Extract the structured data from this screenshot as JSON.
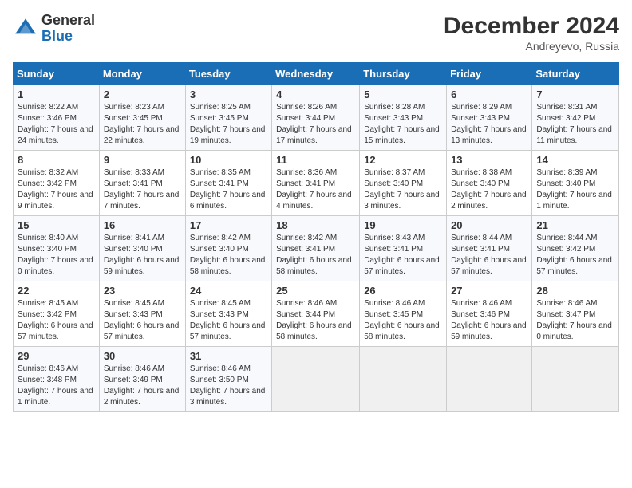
{
  "header": {
    "logo_general": "General",
    "logo_blue": "Blue",
    "month_title": "December 2024",
    "location": "Andreyevo, Russia"
  },
  "columns": [
    "Sunday",
    "Monday",
    "Tuesday",
    "Wednesday",
    "Thursday",
    "Friday",
    "Saturday"
  ],
  "weeks": [
    [
      {
        "day": "1",
        "sunrise": "Sunrise: 8:22 AM",
        "sunset": "Sunset: 3:46 PM",
        "daylight": "Daylight: 7 hours and 24 minutes."
      },
      {
        "day": "2",
        "sunrise": "Sunrise: 8:23 AM",
        "sunset": "Sunset: 3:45 PM",
        "daylight": "Daylight: 7 hours and 22 minutes."
      },
      {
        "day": "3",
        "sunrise": "Sunrise: 8:25 AM",
        "sunset": "Sunset: 3:45 PM",
        "daylight": "Daylight: 7 hours and 19 minutes."
      },
      {
        "day": "4",
        "sunrise": "Sunrise: 8:26 AM",
        "sunset": "Sunset: 3:44 PM",
        "daylight": "Daylight: 7 hours and 17 minutes."
      },
      {
        "day": "5",
        "sunrise": "Sunrise: 8:28 AM",
        "sunset": "Sunset: 3:43 PM",
        "daylight": "Daylight: 7 hours and 15 minutes."
      },
      {
        "day": "6",
        "sunrise": "Sunrise: 8:29 AM",
        "sunset": "Sunset: 3:43 PM",
        "daylight": "Daylight: 7 hours and 13 minutes."
      },
      {
        "day": "7",
        "sunrise": "Sunrise: 8:31 AM",
        "sunset": "Sunset: 3:42 PM",
        "daylight": "Daylight: 7 hours and 11 minutes."
      }
    ],
    [
      {
        "day": "8",
        "sunrise": "Sunrise: 8:32 AM",
        "sunset": "Sunset: 3:42 PM",
        "daylight": "Daylight: 7 hours and 9 minutes."
      },
      {
        "day": "9",
        "sunrise": "Sunrise: 8:33 AM",
        "sunset": "Sunset: 3:41 PM",
        "daylight": "Daylight: 7 hours and 7 minutes."
      },
      {
        "day": "10",
        "sunrise": "Sunrise: 8:35 AM",
        "sunset": "Sunset: 3:41 PM",
        "daylight": "Daylight: 7 hours and 6 minutes."
      },
      {
        "day": "11",
        "sunrise": "Sunrise: 8:36 AM",
        "sunset": "Sunset: 3:41 PM",
        "daylight": "Daylight: 7 hours and 4 minutes."
      },
      {
        "day": "12",
        "sunrise": "Sunrise: 8:37 AM",
        "sunset": "Sunset: 3:40 PM",
        "daylight": "Daylight: 7 hours and 3 minutes."
      },
      {
        "day": "13",
        "sunrise": "Sunrise: 8:38 AM",
        "sunset": "Sunset: 3:40 PM",
        "daylight": "Daylight: 7 hours and 2 minutes."
      },
      {
        "day": "14",
        "sunrise": "Sunrise: 8:39 AM",
        "sunset": "Sunset: 3:40 PM",
        "daylight": "Daylight: 7 hours and 1 minute."
      }
    ],
    [
      {
        "day": "15",
        "sunrise": "Sunrise: 8:40 AM",
        "sunset": "Sunset: 3:40 PM",
        "daylight": "Daylight: 7 hours and 0 minutes."
      },
      {
        "day": "16",
        "sunrise": "Sunrise: 8:41 AM",
        "sunset": "Sunset: 3:40 PM",
        "daylight": "Daylight: 6 hours and 59 minutes."
      },
      {
        "day": "17",
        "sunrise": "Sunrise: 8:42 AM",
        "sunset": "Sunset: 3:40 PM",
        "daylight": "Daylight: 6 hours and 58 minutes."
      },
      {
        "day": "18",
        "sunrise": "Sunrise: 8:42 AM",
        "sunset": "Sunset: 3:41 PM",
        "daylight": "Daylight: 6 hours and 58 minutes."
      },
      {
        "day": "19",
        "sunrise": "Sunrise: 8:43 AM",
        "sunset": "Sunset: 3:41 PM",
        "daylight": "Daylight: 6 hours and 57 minutes."
      },
      {
        "day": "20",
        "sunrise": "Sunrise: 8:44 AM",
        "sunset": "Sunset: 3:41 PM",
        "daylight": "Daylight: 6 hours and 57 minutes."
      },
      {
        "day": "21",
        "sunrise": "Sunrise: 8:44 AM",
        "sunset": "Sunset: 3:42 PM",
        "daylight": "Daylight: 6 hours and 57 minutes."
      }
    ],
    [
      {
        "day": "22",
        "sunrise": "Sunrise: 8:45 AM",
        "sunset": "Sunset: 3:42 PM",
        "daylight": "Daylight: 6 hours and 57 minutes."
      },
      {
        "day": "23",
        "sunrise": "Sunrise: 8:45 AM",
        "sunset": "Sunset: 3:43 PM",
        "daylight": "Daylight: 6 hours and 57 minutes."
      },
      {
        "day": "24",
        "sunrise": "Sunrise: 8:45 AM",
        "sunset": "Sunset: 3:43 PM",
        "daylight": "Daylight: 6 hours and 57 minutes."
      },
      {
        "day": "25",
        "sunrise": "Sunrise: 8:46 AM",
        "sunset": "Sunset: 3:44 PM",
        "daylight": "Daylight: 6 hours and 58 minutes."
      },
      {
        "day": "26",
        "sunrise": "Sunrise: 8:46 AM",
        "sunset": "Sunset: 3:45 PM",
        "daylight": "Daylight: 6 hours and 58 minutes."
      },
      {
        "day": "27",
        "sunrise": "Sunrise: 8:46 AM",
        "sunset": "Sunset: 3:46 PM",
        "daylight": "Daylight: 6 hours and 59 minutes."
      },
      {
        "day": "28",
        "sunrise": "Sunrise: 8:46 AM",
        "sunset": "Sunset: 3:47 PM",
        "daylight": "Daylight: 7 hours and 0 minutes."
      }
    ],
    [
      {
        "day": "29",
        "sunrise": "Sunrise: 8:46 AM",
        "sunset": "Sunset: 3:48 PM",
        "daylight": "Daylight: 7 hours and 1 minute."
      },
      {
        "day": "30",
        "sunrise": "Sunrise: 8:46 AM",
        "sunset": "Sunset: 3:49 PM",
        "daylight": "Daylight: 7 hours and 2 minutes."
      },
      {
        "day": "31",
        "sunrise": "Sunrise: 8:46 AM",
        "sunset": "Sunset: 3:50 PM",
        "daylight": "Daylight: 7 hours and 3 minutes."
      },
      null,
      null,
      null,
      null
    ]
  ]
}
